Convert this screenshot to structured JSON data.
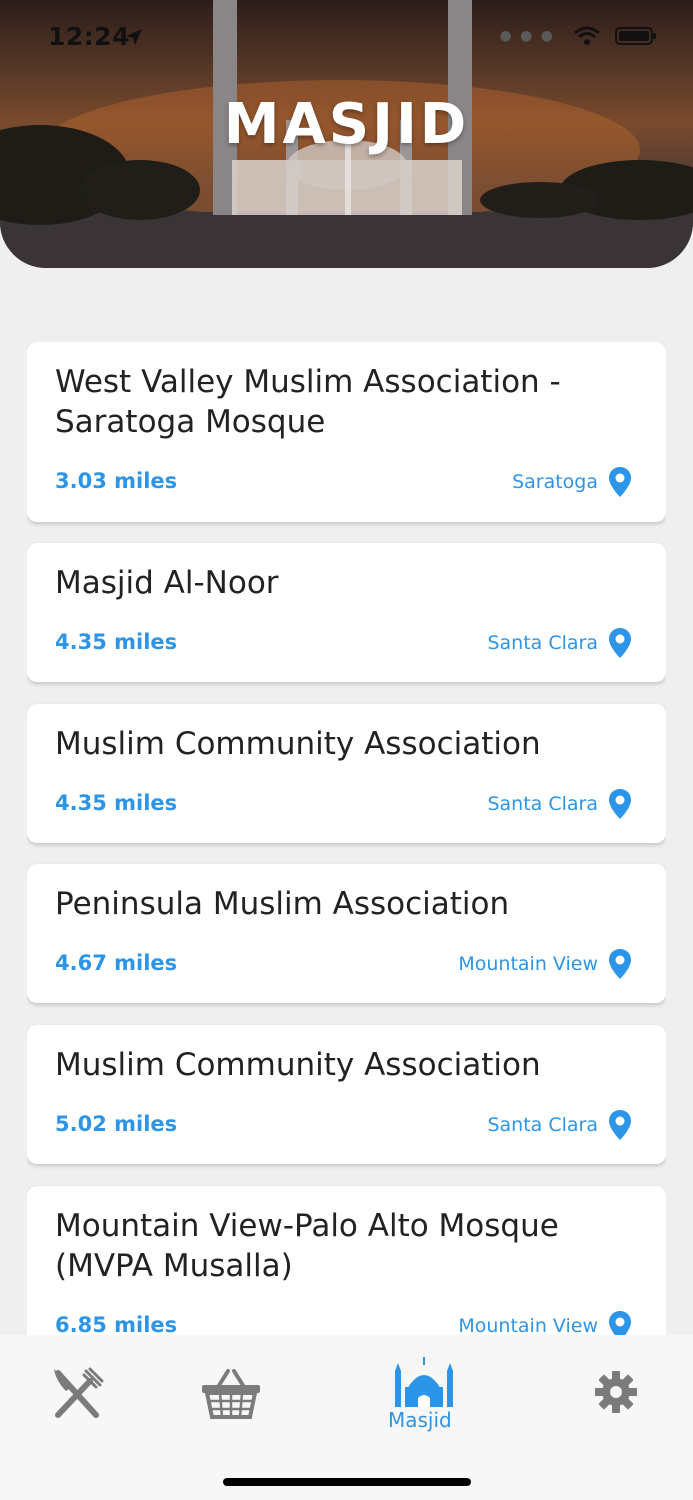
{
  "status_bar": {
    "time": "12:24"
  },
  "header": {
    "title": "MASJID"
  },
  "mosques": [
    {
      "name": "West Valley Muslim Association - Saratoga Mosque",
      "distance": "3.03 miles",
      "city": "Saratoga"
    },
    {
      "name": "Masjid Al-Noor",
      "distance": "4.35 miles",
      "city": "Santa Clara"
    },
    {
      "name": "Muslim Community Association",
      "distance": "4.35 miles",
      "city": "Santa Clara"
    },
    {
      "name": "Peninsula Muslim Association",
      "distance": "4.67 miles",
      "city": "Mountain View"
    },
    {
      "name": "Muslim Community Association",
      "distance": "5.02 miles",
      "city": "Santa Clara"
    },
    {
      "name": "Mountain View-Palo Alto Mosque (MVPA Musalla)",
      "distance": "6.85 miles",
      "city": "Mountain View"
    }
  ],
  "tabbar": {
    "tabs": [
      {
        "icon": "fork-knife-icon",
        "label": ""
      },
      {
        "icon": "basket-icon",
        "label": ""
      },
      {
        "icon": "mosque-icon",
        "label": "Masjid",
        "active": true
      },
      {
        "icon": "gear-icon",
        "label": ""
      }
    ]
  },
  "colors": {
    "accent": "#2d95e8",
    "inactive_icon": "#7b7b7b"
  }
}
